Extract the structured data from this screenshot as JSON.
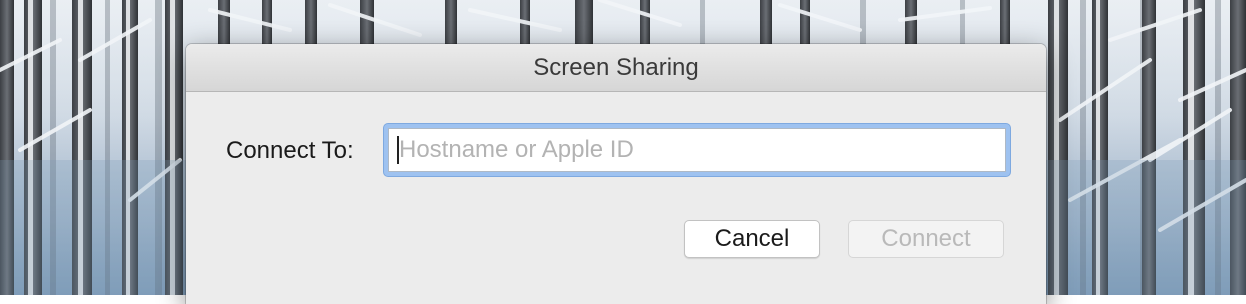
{
  "dialog": {
    "title": "Screen Sharing",
    "connect_label": "Connect To:",
    "address_field": {
      "value": "",
      "placeholder": "Hostname or Apple ID"
    },
    "buttons": {
      "cancel": "Cancel",
      "connect": "Connect",
      "connect_enabled": false
    }
  }
}
